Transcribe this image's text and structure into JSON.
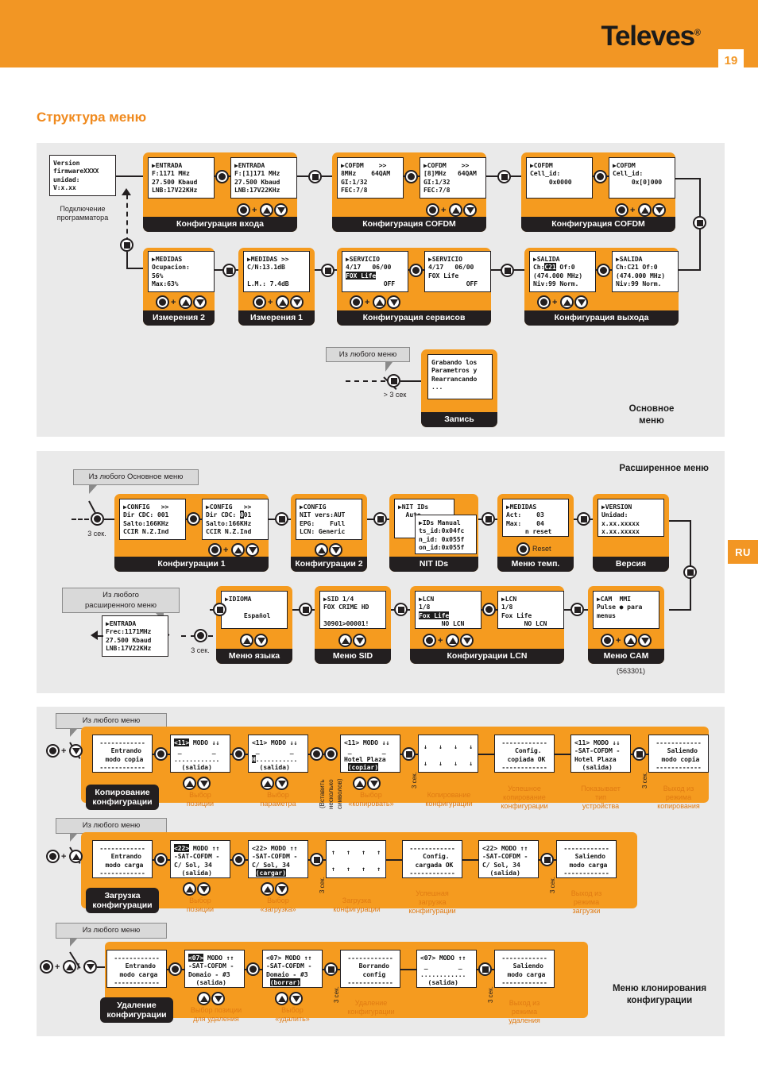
{
  "header": {
    "brand": "Televes",
    "brand_reg": "®",
    "page_number": "19",
    "language_tab": "RU"
  },
  "page_title": "Структура меню",
  "sections": {
    "main": {
      "caption_line1": "Основное",
      "caption_line2": "меню",
      "connect_note_line1": "Подключение",
      "connect_note_line2": "программатора",
      "version_screen": "Version\nfirmwareXXXX\nunidad:\nV:x.xx",
      "steps": [
        {
          "group_label": "Конфигурация входа",
          "screens": [
            "▶ENTRADA\nF:1171 MHz\n27.500 Kbaud\nLNB:17V22KHz",
            "▶ENTRADA\nF:[1]171 MHz\n27.500 Kbaud\nLNB:17V22KHz"
          ]
        },
        {
          "group_label": "Конфигурация COFDM",
          "screens": [
            "▶COFDM    >>\n8MHz    64QAM\nGI:1/32\nFEC:7/8",
            "▶COFDM    >>\n[8]MHz   64QAM\nGI:1/32\nFEC:7/8"
          ]
        },
        {
          "group_label": "Конфигурация COFDM",
          "screens": [
            "▶COFDM\nCell_id:\n     0x0000",
            "▶COFDM\nCell_id:\n     0x[0]000"
          ]
        },
        {
          "group_label": "Измерения 2",
          "screens": [
            "▶MEDIDAS\nOcupacion:\n56%\nMax:63%"
          ]
        },
        {
          "group_label": "Измерения 1",
          "screens": [
            "▶MEDIDAS >>\nC/N:13.1dB\n\nL.M.: 7.4dB"
          ]
        },
        {
          "group_label": "Конфигурация сервисов",
          "screens": [
            "▶SERVICIO\n4/17   06/00\n[FOX Life]\n          OFF",
            "▶SERVICIO\n4/17   06/00\nFOX Life\n          OFF"
          ]
        },
        {
          "group_label": "Конфигурация выхода",
          "screens": [
            "▶SALIDA\nCh:[C21] Of:0\n(474.000 MHz)\nNiv:99 Norm.",
            "▶SALIDA\nCh:C21 Of:0\n(474.000 MHz)\nNiv:99 Norm."
          ]
        }
      ],
      "record": {
        "callout": "Из любого меню",
        "timing": "> 3 сек",
        "screen": "Grabando los\nParametros y\nRearrancando\n...",
        "group_label": "Запись"
      }
    },
    "extended": {
      "caption": "Расширенное меню",
      "model_code": "(563301)",
      "callout_top": "Из любого  Основное меню",
      "callout_bottom_line1": "Из любого",
      "callout_bottom_line2": "расширенного меню",
      "timing_top": "3 сек.",
      "timing_bottom": "3 сек.",
      "return_screen": "▶ENTRADA\nFrec:1171MHz\n27.500 Kbaud\nLNB:17V22KHz",
      "steps": [
        {
          "group_label": "Конфигурации 1",
          "screens": [
            "▶CONFIG   >>\nDir CDC: 001\nSalto:166KHz\nCCIR N.Z.Ind",
            "▶CONFIG   >>\nDir CDC: [0]01\nSalto:166KHz\nCCIR N.Z.Ind"
          ]
        },
        {
          "group_label": "Конфигурации 2",
          "screens": [
            "▶CONFIG\nNIT vers:AUT\nEPG:    Full\nLCN: Generic"
          ]
        },
        {
          "group_label": "NIT IDs",
          "screens": [
            "▶NIT IDs\n  Auto",
            "▶IDs Manual\nts_id:0x04fc\nn_id: 0x055f\non_id:0x055f"
          ]
        },
        {
          "group_label": "Меню темп.",
          "screens": [
            "▶MEDIDAS\nAct:    03\nMax:    04\n     n reset"
          ],
          "reset_label": "Reset"
        },
        {
          "group_label": "Версия",
          "screens": [
            "▶VERSION\nUnidad:\nx.xx.xxxxx\nx.xx.xxxxx"
          ]
        },
        {
          "group_label": "Меню языка",
          "screens": [
            "▶IDIOMA\n\n     Español"
          ]
        },
        {
          "group_label": "Меню SID",
          "screens": [
            "▶SID 1/4\nFOX CRIME HD\n\n30901>00001!"
          ]
        },
        {
          "group_label": "Конфигурации LCN",
          "screens": [
            "▶LCN\n1/8\n[Fox Life]\n      NO LCN",
            "▶LCN\n1/8\nFox Life\n      NO LCN"
          ]
        },
        {
          "group_label": "Меню CAM",
          "screens": [
            "▶CAM  MMI\nPulse ● para\nmenus"
          ]
        }
      ]
    },
    "clone": {
      "caption_line1": "Меню клонирования",
      "caption_line2": "конфигурации",
      "rows": [
        {
          "callout": "Из любого меню",
          "pill_line1": "Копирование",
          "pill_line2": "конфигурации",
          "screens": [
            "------------\n  Entrando\n modo copia\n------------",
            "[<11>] MODO ↓↓\n _        _\n............\n  (salida)",
            "<11> MODO ↓↓\n _        _\n[H]...........\n  (salida)",
            "<11> MODO ↓↓\n _        _\nHotel Plaza\n [(copiar)]",
            "↓   ↓   ↓   ↓\n\n↓   ↓   ↓   ↓",
            "------------\n  Config.\n copiada OK\n------------",
            "<11> MODO ↓↓\n-SAT-COFDM -\nHotel Plaza\n  (salida)",
            "------------\n  Saliendo\n modo copia\n------------"
          ],
          "notes": [
            "Выбор\nпозиции",
            "Выбор\nпараметра",
            "Выбор\n«копировать»",
            "Копирование\nконфигурации",
            "Успешное\nкопирование\nконфигурации",
            "Показывает\nтип\nустройства",
            "Выход из\nрежима\nкопирования"
          ],
          "insert_note": "(Вставить\nнесколько\nсимволов)",
          "timing": "3 сек."
        },
        {
          "callout": "Из любого меню",
          "pill_line1": "Загрузка",
          "pill_line2": "конфигурации",
          "screens": [
            "------------\n  Entrando\n modo carga\n------------",
            "[<22>] MODO ↑↑\n-SAT-COFDM -\nC/ Sol, 34\n  (salida)",
            "<22> MODO ↑↑\n-SAT-COFDM -\nC/ Sol, 34\n [(cargar)]",
            "↑   ↑   ↑   ↑\n\n↑   ↑   ↑   ↑",
            "------------\n  Config.\n cargada OK\n------------",
            "<22> MODO ↑↑\n-SAT-COFDM -\nC/ Sol, 34\n  (salida)",
            "------------\n  Saliendo\n modo carga\n------------"
          ],
          "notes": [
            "Выбор\nпозиции",
            "Выбор\n«загрузка»",
            "Загрузка\nконфигурации",
            "Успешная\nзагрузка\nконфигурации",
            "Выход из\nрежима\nзагрузки"
          ],
          "timing": "3 сек."
        },
        {
          "callout": "Из любого меню",
          "pill_line1": "Удаление",
          "pill_line2": "конфигурации",
          "screens": [
            "------------\n  Entrando\n modo carga\n------------",
            "[<07>] MODO ↑↑\n-SAT-COFDM -\nDomaio - #3\n  (salida)",
            "<07> MODO ↑↑\n-SAT-COFDM -\nDomaio - #3\n [(borrar)]",
            "------------\n  Borrando\n  config\n------------",
            "<07> MODO ↑↑\n _        _\n............\n  (salida)",
            "------------\n  Saliendo\n modo carga\n------------"
          ],
          "notes": [
            "Выбор позиции\nдля удаления",
            "Выбор\n«удалить»",
            "Удаление\nконфигурации",
            "Выход из\nрежима\nудаления"
          ],
          "timing": "3 сек."
        }
      ]
    }
  }
}
